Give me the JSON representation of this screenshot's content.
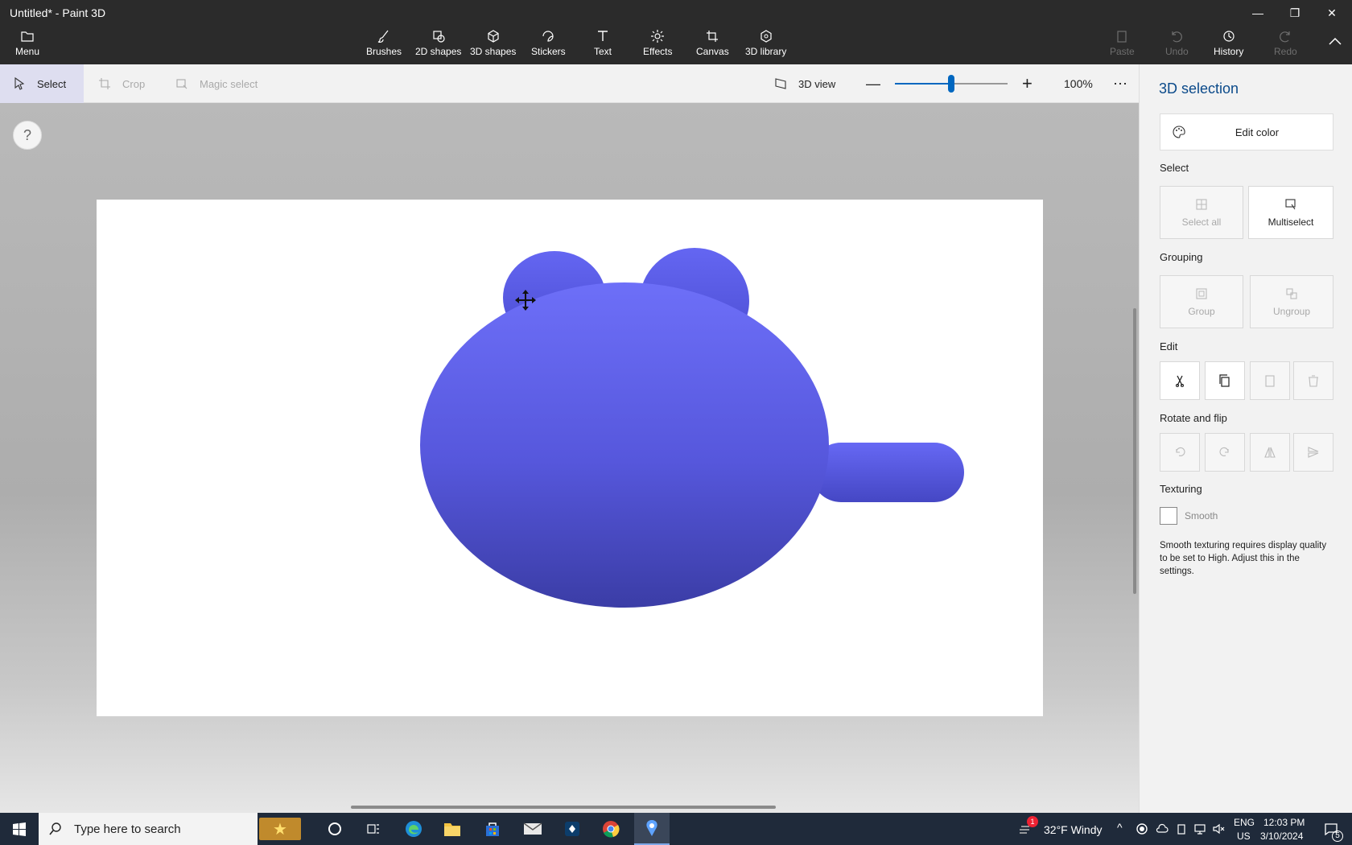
{
  "window": {
    "title": "Untitled* - Paint 3D"
  },
  "toolbar": {
    "menu_label": "Menu",
    "tools": [
      {
        "label": "Brushes",
        "icon": "brush-icon"
      },
      {
        "label": "2D shapes",
        "icon": "2d-shapes-icon"
      },
      {
        "label": "3D shapes",
        "icon": "3d-shapes-icon"
      },
      {
        "label": "Stickers",
        "icon": "stickers-icon"
      },
      {
        "label": "Text",
        "icon": "text-icon"
      },
      {
        "label": "Effects",
        "icon": "effects-icon"
      },
      {
        "label": "Canvas",
        "icon": "canvas-icon"
      },
      {
        "label": "3D library",
        "icon": "3d-library-icon"
      }
    ],
    "right_tools": [
      {
        "label": "Paste",
        "enabled": false
      },
      {
        "label": "Undo",
        "enabled": false
      },
      {
        "label": "History",
        "enabled": true
      },
      {
        "label": "Redo",
        "enabled": false
      }
    ]
  },
  "subbar": {
    "select_label": "Select",
    "crop_label": "Crop",
    "magic_select_label": "Magic select",
    "view_label": "3D view",
    "zoom_percent": "100%",
    "zoom_level": 0.5
  },
  "panel": {
    "title": "3D selection",
    "edit_color_label": "Edit color",
    "select_section": "Select",
    "select_all_label": "Select all",
    "multiselect_label": "Multiselect",
    "grouping_section": "Grouping",
    "group_label": "Group",
    "ungroup_label": "Ungroup",
    "edit_section": "Edit",
    "rotate_section": "Rotate and flip",
    "texturing_section": "Texturing",
    "smooth_label": "Smooth",
    "smooth_note": "Smooth texturing requires display quality to be set to High. Adjust this in the settings."
  },
  "colors": {
    "model_blue": "#5b5cf0",
    "accent": "#0067c0"
  },
  "taskbar": {
    "search_placeholder": "Type here to search",
    "weather": "32°F  Windy",
    "weather_badge": "1",
    "lang": "ENG",
    "region": "US",
    "time": "12:03 PM",
    "date": "3/10/2024",
    "notification_count": "5"
  }
}
